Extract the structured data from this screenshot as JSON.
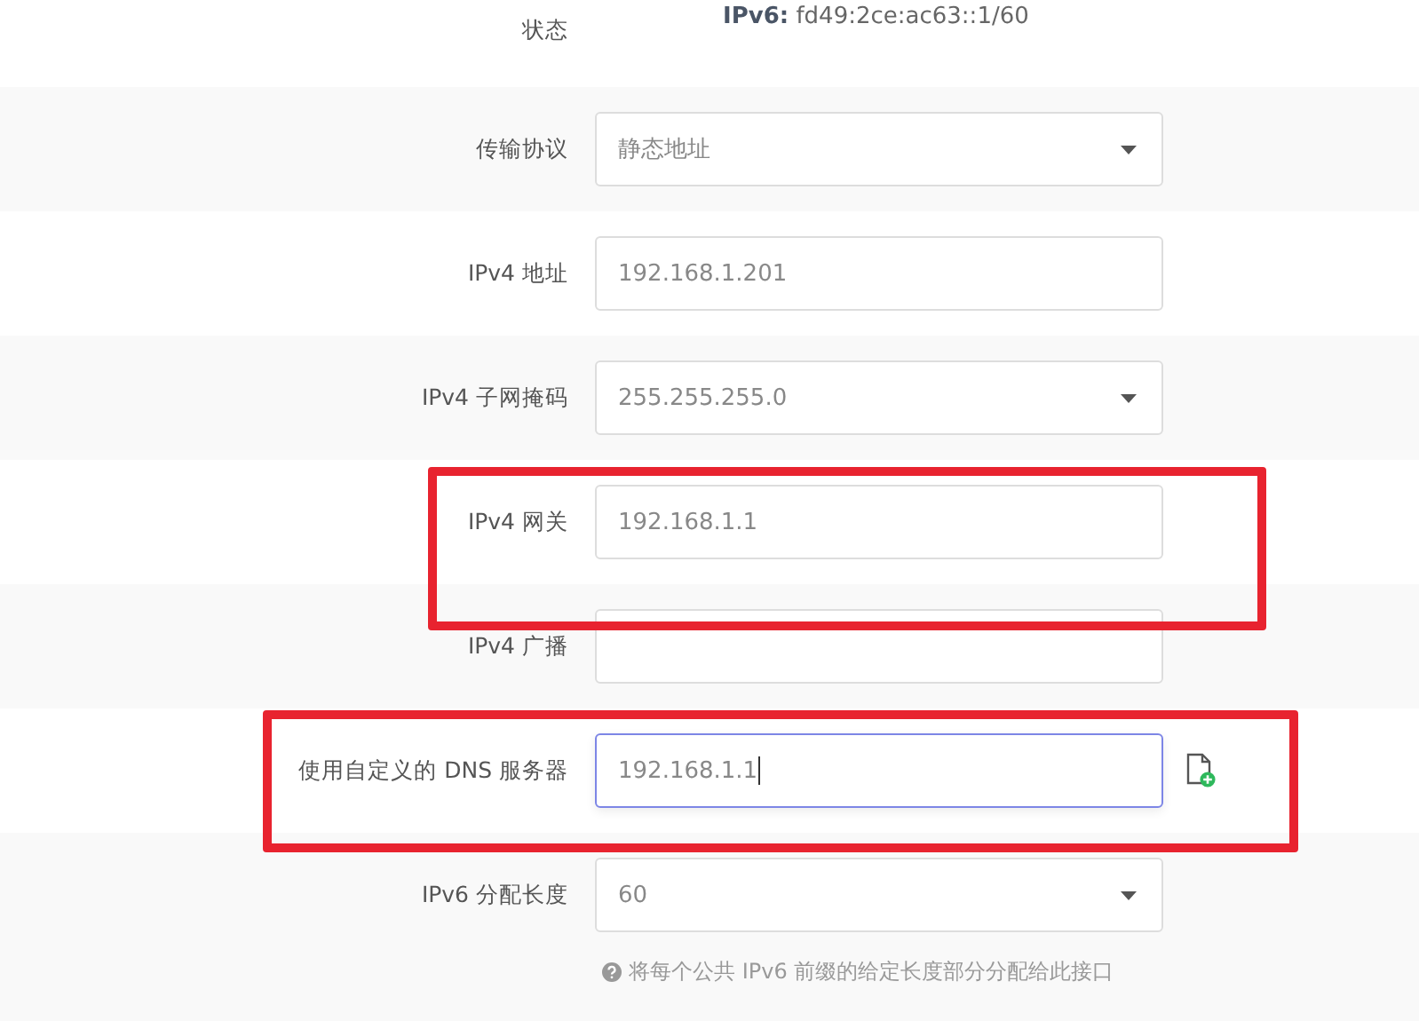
{
  "rows": [
    {
      "kind": "status",
      "label": "状态",
      "status_key": "IPv6:",
      "status_value": "fd49:2ce:ac63::1/60",
      "highlighted": false
    },
    {
      "kind": "select",
      "label": "传输协议",
      "value": "静态地址",
      "highlighted": false
    },
    {
      "kind": "input",
      "label": "IPv4 地址",
      "value": "192.168.1.201",
      "highlighted": false
    },
    {
      "kind": "select",
      "label": "IPv4 子网掩码",
      "value": "255.255.255.0",
      "highlighted": false
    },
    {
      "kind": "input",
      "label": "IPv4 网关",
      "value": "192.168.1.1",
      "highlighted": true
    },
    {
      "kind": "input",
      "label": "IPv4 广播",
      "highlighted": false
    },
    {
      "kind": "input",
      "label": "使用自定义的 DNS 服务器",
      "value": "192.168.1.1",
      "focused": true,
      "add_button": true,
      "highlighted": true
    },
    {
      "kind": "select",
      "label": "IPv6 分配长度",
      "value": "60",
      "help": "将每个公共 IPv6 前缀的给定长度部分分配给此接口",
      "highlighted": false
    }
  ]
}
